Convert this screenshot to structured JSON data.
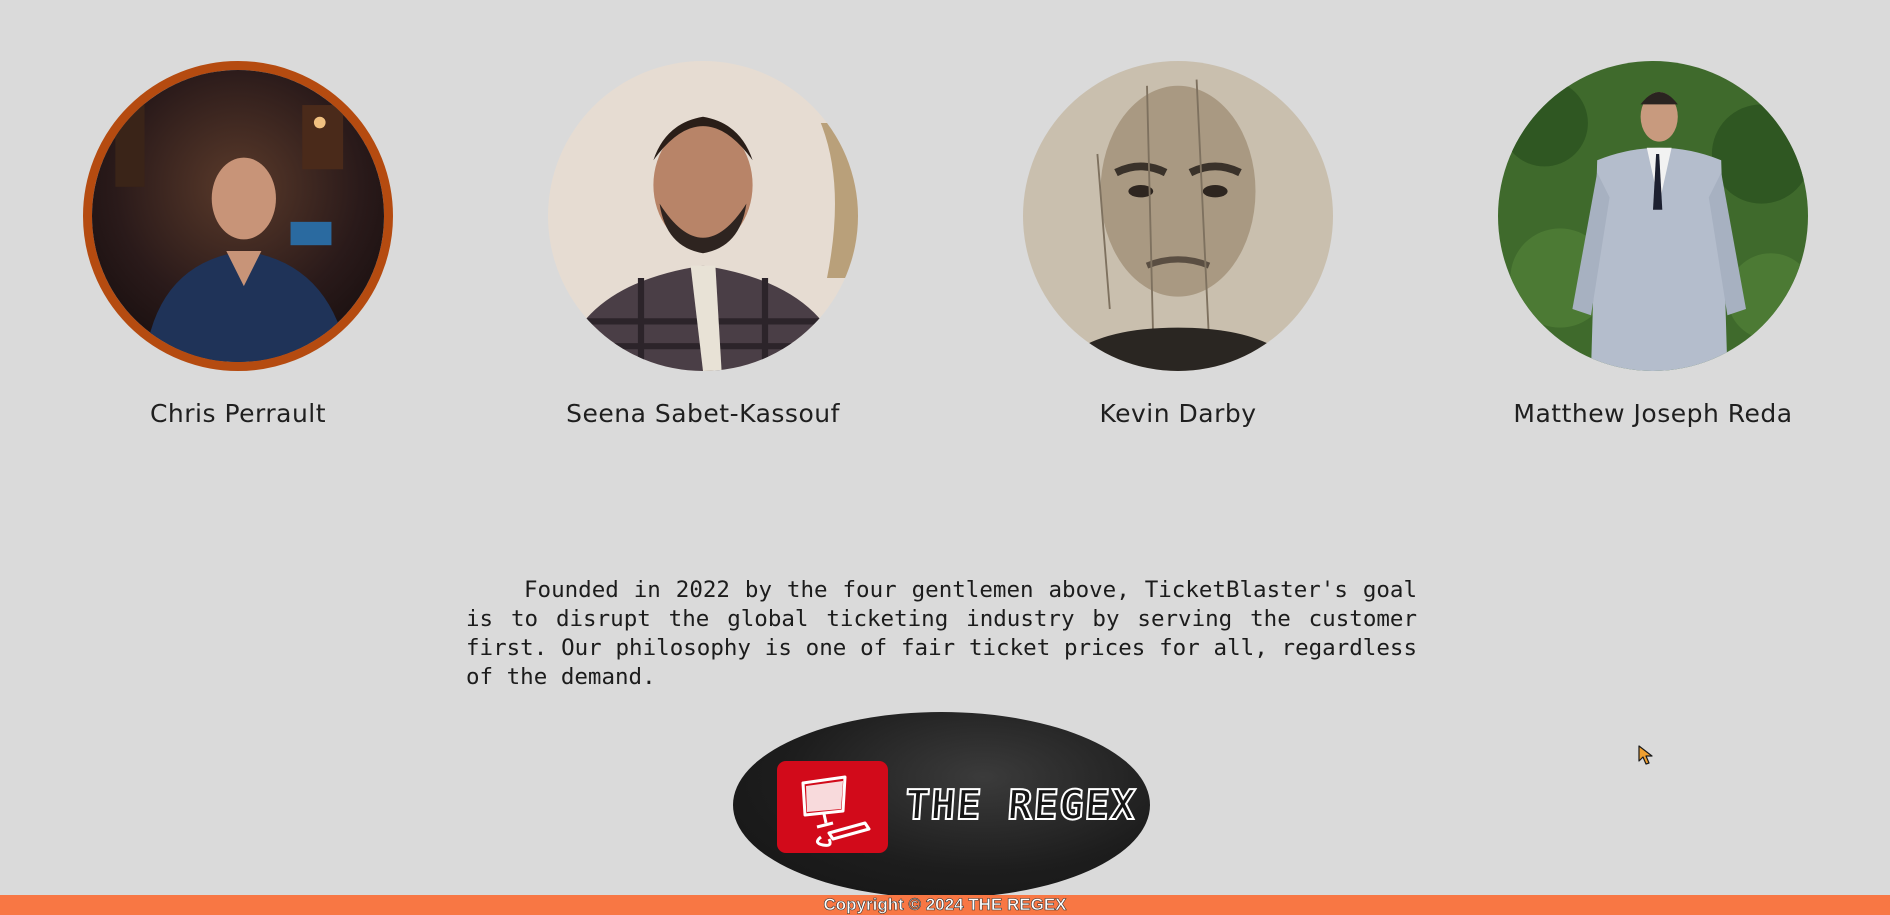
{
  "founders": [
    {
      "name": "Chris Perrault",
      "photo": "portrait-photo"
    },
    {
      "name": "Seena Sabet-Kassouf",
      "photo": "portrait-photo"
    },
    {
      "name": "Kevin Darby",
      "photo": "portrait-photo"
    },
    {
      "name": "Matthew Joseph Reda",
      "photo": "portrait-photo"
    }
  ],
  "about": {
    "text": "Founded in 2022 by the four gentlemen above, TicketBlaster's goal is to disrupt the global ticketing industry by serving the customer first. Our philosophy is one of fair ticket prices for all, regardless of the demand."
  },
  "logo": {
    "text": "THE REGEX",
    "icon": "computer-icon",
    "box_color": "#d20a1a"
  },
  "footer": {
    "copyright": "Copyright © 2024 THE REGEX",
    "color": "#f87744"
  },
  "colors": {
    "background": "#dadada"
  }
}
